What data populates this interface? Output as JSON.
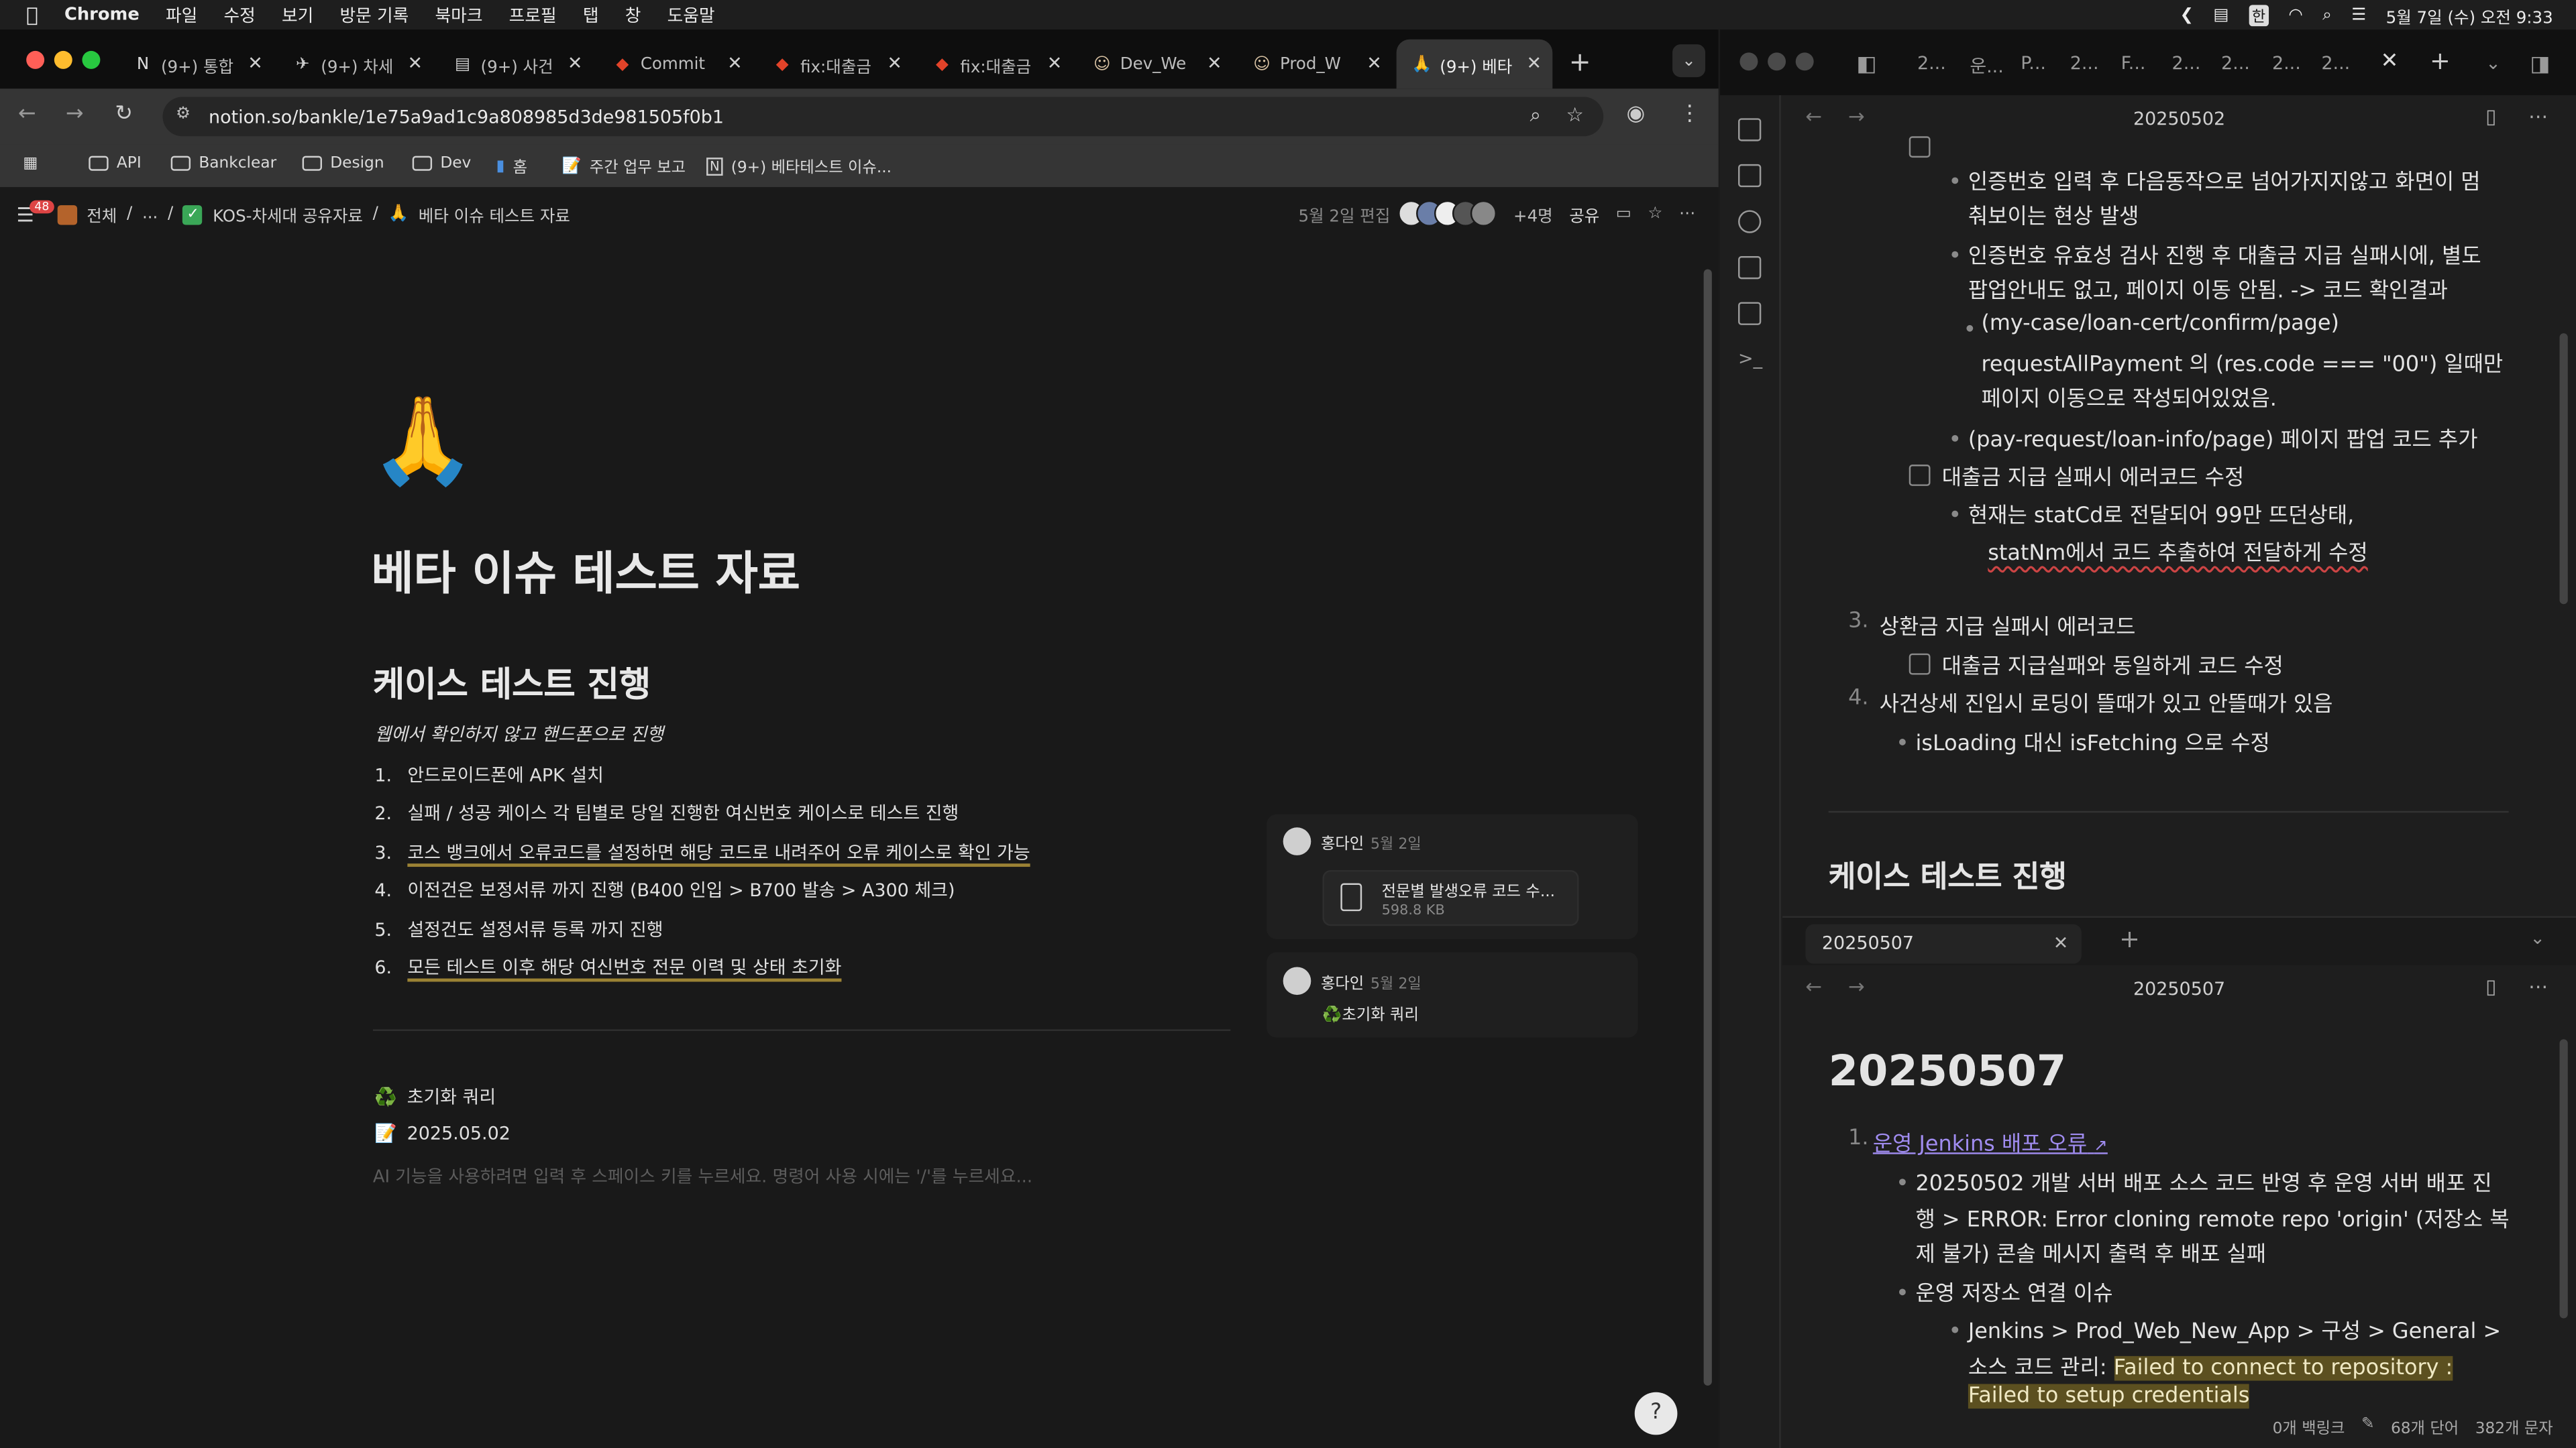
{
  "menubar": {
    "app": "Chrome",
    "items": [
      "파일",
      "수정",
      "보기",
      "방문 기록",
      "북마크",
      "프로필",
      "탭",
      "창",
      "도움말"
    ],
    "clock": "5월 7일 (수) 오전 9:33",
    "input_lang": "한"
  },
  "tabs": [
    {
      "title": "(9+) 통합",
      "icon": "notion-icon",
      "active": false
    },
    {
      "title": "(9+) 차세",
      "icon": "bird-icon",
      "active": false
    },
    {
      "title": "(9+) 사건",
      "icon": "doc-icon",
      "active": false
    },
    {
      "title": "Commit",
      "icon": "gitlab-icon",
      "active": false
    },
    {
      "title": "fix:대출금",
      "icon": "gitlab-icon",
      "active": false
    },
    {
      "title": "fix:대출금",
      "icon": "gitlab-icon",
      "active": false
    },
    {
      "title": "Dev_We",
      "icon": "jenkins-icon",
      "active": false
    },
    {
      "title": "Prod_W",
      "icon": "jenkins-icon",
      "active": false
    },
    {
      "title": "(9+) 베타",
      "icon": "pray-icon",
      "active": true
    }
  ],
  "address": {
    "url": "notion.so/bankle/1e75a9ad1c9a808985d3de981505f0b1"
  },
  "bookmarks": [
    "API",
    "Bankclear",
    "Design",
    "Dev",
    "홈",
    "주간 업무 보고",
    "(9+) 베타테스트 이슈..."
  ],
  "notion": {
    "badge_count": "48",
    "breadcrumbs": [
      "전체",
      "...",
      "KOS-차세대 공유자료",
      "베타 이슈 테스트 자료"
    ],
    "edited": "5월 2일 편집",
    "avatar_extra": "+4명",
    "share": "공유",
    "page_icon": "🙏",
    "title": "베타 이슈 테스트 자료",
    "heading": "케이스 테스트 진행",
    "note": "웹에서 확인하지 않고 핸드폰으로 진행",
    "items": [
      "안드로이드폰에 APK 설치",
      "실패 / 성공 케이스 각 팀별로 당일 진행한 여신번호 케이스로 테스트 진행",
      "코스 뱅크에서 오류코드를 설정하면 해당 코드로 내려주어 오류 케이스로 확인 가능",
      "이전건은 보정서류 까지 진행 (B400 인입 > B700 발송 > A300 체크)",
      "설정건도 설정서류 등록 까지 진행",
      "모든 테스트 이후 해당 여신번호 전문 이력 및 상태 초기화"
    ],
    "subpages": [
      {
        "icon": "♻️",
        "title": "초기화 쿼리"
      },
      {
        "icon": "📝",
        "title": "2025.05.02"
      }
    ],
    "placeholder": "AI 기능을 사용하려면 입력 후 스페이스 키를 누르세요. 명령어 사용 시에는 '/'를 누르세요...",
    "comments": [
      {
        "author": "홍다인",
        "date": "5월 2일",
        "file": "전문별 발생오류 코드 수...",
        "size": "598.8 KB"
      },
      {
        "author": "홍다인",
        "date": "5월 2일",
        "link": "초기화 쿼리"
      }
    ]
  },
  "editor": {
    "tabs": [
      "2...",
      "운...",
      "P...",
      "2...",
      "F...",
      "2...",
      "2...",
      "2...",
      "2..."
    ],
    "top": {
      "title": "20250502",
      "lines": [
        "인증번호 입력 후 다음동작으로 넘어가지지않고 화면이 멈",
        "춰보이는 현상 발생",
        "인증번호 유효성 검사 진행 후 대출금 지급 실패시에, 별도",
        "팝업안내도 없고, 페이지 이동 안됨. -> 코드 확인결과",
        "(my-case/loan-cert/confirm/page)",
        "requestAllPayment 의 (res.code === \"00\") 일때만",
        "페이지 이동으로 작성되어있었음.",
        "(pay-request/loan-info/page) 페이지 팝업 코드 추가",
        "대출금 지급 실패시 에러코드 수정",
        "현재는 statCd로 전달되어 99만 뜨던상태,",
        "statNm에서 코드 추출하여 전달하게 수정",
        "3.",
        "상환금 지급 실패시 에러코드",
        "대출금 지급실패와 동일하게 코드 수정",
        "4.",
        "사건상세 진입시 로딩이 뜰때가 있고 안뜰때가 있음",
        "isLoading 대신 isFetching 으로 수정",
        "케이스 테스트 진행"
      ]
    },
    "bottom": {
      "tab": "20250507",
      "title": "20250507",
      "heading": "20250507",
      "num1": "1.",
      "link": "운영 Jenkins 배포 오류",
      "lines": [
        "20250502 개발 서버 배포 소스 코드 반영 후 운영 서버 배포 진",
        "행 > ERROR: Error cloning remote repo 'origin' (저장소 복",
        "제 불가) 콘솔 메시지 출력 후 배포 실패",
        "운영 저장소 연결 이슈",
        "Jenkins > Prod_Web_New_App > 구성 > General >",
        "소스 코드 관리: ",
        "Failed to connect to repository :",
        "Failed to setup credentials"
      ]
    },
    "status": [
      "0개 백링크",
      "68개 단어",
      "382개 문자"
    ]
  }
}
